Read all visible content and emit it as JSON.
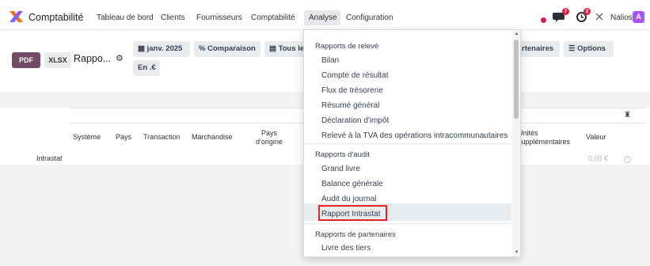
{
  "navbar": {
    "app_name": "Comptabilité",
    "menu": [
      "Tableau de bord",
      "Clients",
      "Fournisseurs",
      "Comptabilité",
      "Analyse",
      "Configuration"
    ],
    "active_menu": "Analyse",
    "messages_badge": "7",
    "activities_badge": "2",
    "company": "Nalios",
    "avatar_letter": "A",
    "colors": {
      "accent": "#714b67",
      "badge": "#e11d48",
      "avatar": "#a855f7"
    }
  },
  "controls": {
    "pdf_label": "PDF",
    "xlsx_label": "XLSX",
    "report_title": "Rappo...",
    "date_filter": "janv. 2025",
    "comparison": "Comparaison",
    "journals": "Tous le",
    "currency": "En .€",
    "partners": "rtenaires",
    "options": "Options"
  },
  "table": {
    "columns": [
      "Système",
      "Pays",
      "Transaction",
      "Marchandise",
      "Pays d'origine",
      "Unités supplémentaires",
      "Valeur"
    ],
    "row_label": "Intrastat",
    "row_value": "0,00 €"
  },
  "dropdown": {
    "sections": [
      {
        "header": "Rapports de relevé",
        "items": [
          "Bilan",
          "Compte de résultat",
          "Flux de trésorerie",
          "Résumé général",
          "Déclaration d'impôt",
          "Relevé à la TVA des opérations intracommunautaires"
        ]
      },
      {
        "header": "Rapports d'audit",
        "items": [
          "Grand livre",
          "Balance générale",
          "Audit du journal",
          "Rapport Intrastat"
        ]
      },
      {
        "header": "Rapports de partenaires",
        "items": [
          "Livre des tiers"
        ]
      }
    ],
    "highlighted_item": "Rapport Intrastat"
  }
}
